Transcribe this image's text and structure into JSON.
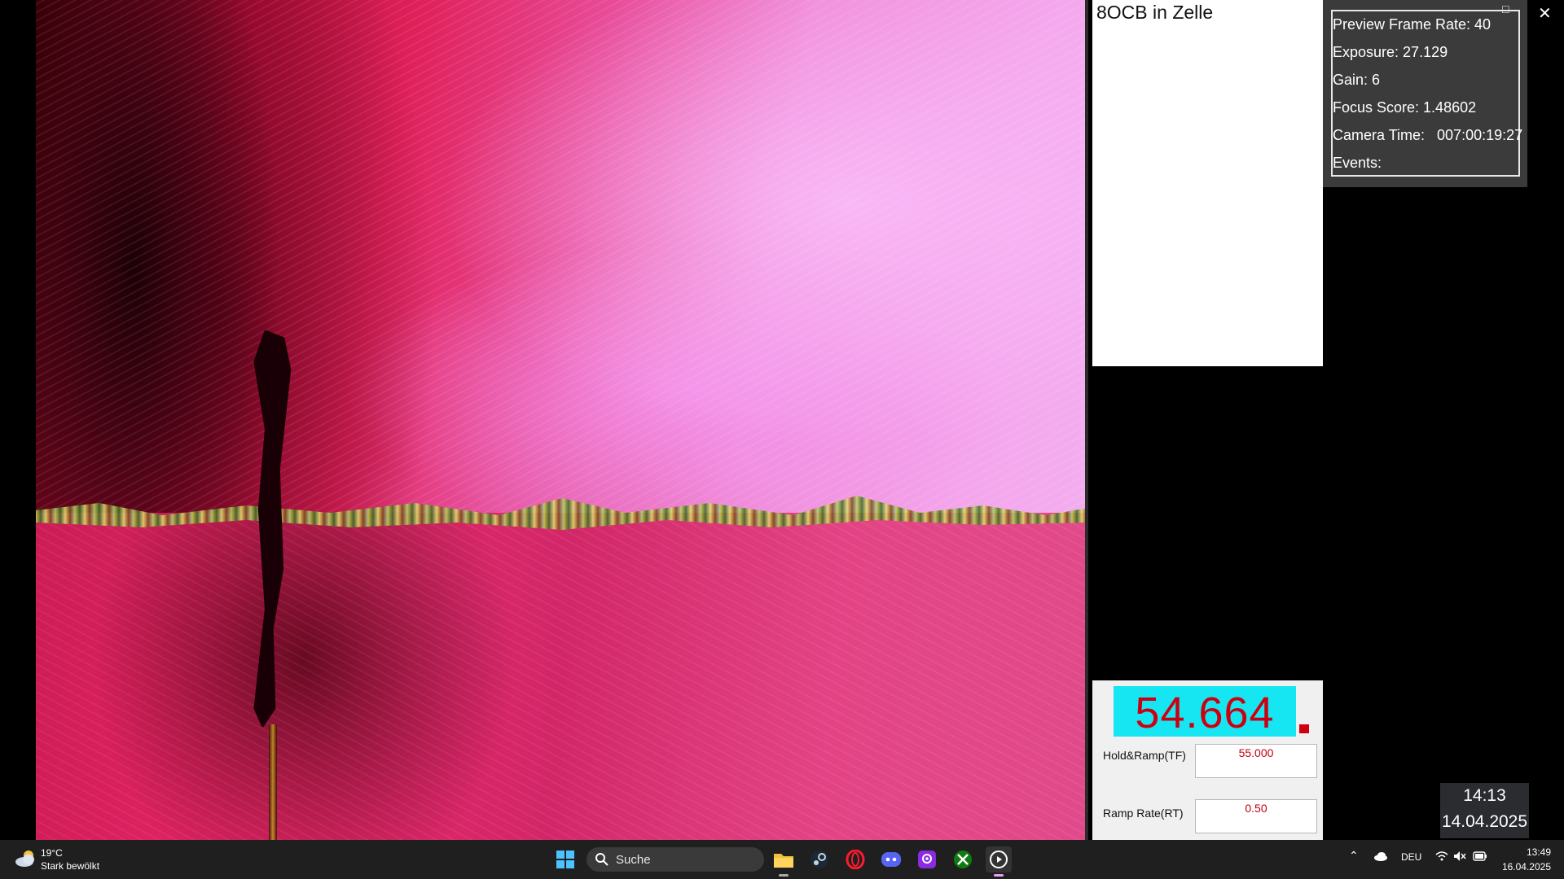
{
  "sample_title": "8OCB in Zelle",
  "camera_info": {
    "preview_frame_rate": "Preview Frame Rate: 40",
    "exposure": "Exposure: 27.129",
    "gain": "Gain: 6",
    "focus_score": "Focus Score: 1.48602",
    "camera_time": "Camera Time:   007:00:19:27",
    "events": "Events:",
    "min_glyph": "–",
    "max_glyph": "□",
    "close_glyph": "✕"
  },
  "controller": {
    "temperature_display": "54.664",
    "hold_ramp_label": "Hold&Ramp(TF)",
    "hold_ramp_value": "55.000",
    "ramp_rate_label": "Ramp Rate(RT)",
    "ramp_rate_value": "0.50",
    "display_color": "#16e6f2",
    "value_color": "#cc0010"
  },
  "overlay_clock": {
    "time": "14:13",
    "date": "14.04.2025"
  },
  "taskbar": {
    "weather_temp": "19°C",
    "weather_desc": "Stark bewölkt",
    "search_placeholder": "Suche",
    "apps": [
      "start-icon",
      "file-explorer-icon",
      "steam-icon",
      "opera-icon",
      "discord-icon",
      "podcast-app-icon",
      "xbox-icon",
      "media-player-icon"
    ],
    "tray_language": "DEU",
    "time": "13:49",
    "date": "16.04.2025"
  }
}
